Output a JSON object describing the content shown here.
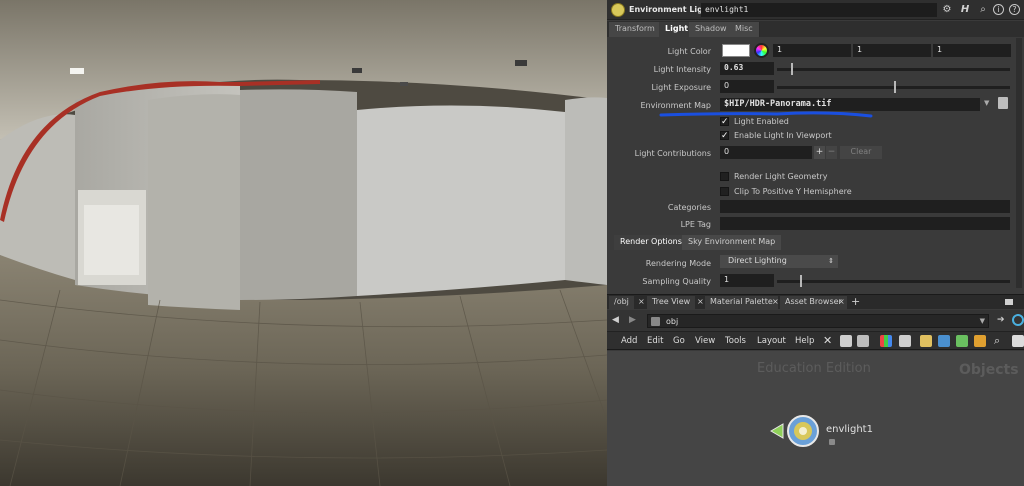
{
  "parameter_editor": {
    "node_type": "Environment Light",
    "node_name": "envlight1",
    "tabs": [
      "Transform",
      "Light",
      "Shadow",
      "Misc"
    ],
    "active_tab": "Light",
    "light_color": {
      "label": "Light Color",
      "values": [
        "1",
        "1",
        "1"
      ],
      "swatch": "#ffffff"
    },
    "light_intensity": {
      "label": "Light Intensity",
      "value": "0.63",
      "slider_fraction": 0.06
    },
    "light_exposure": {
      "label": "Light Exposure",
      "value": "0",
      "slider_fraction": 0.5
    },
    "environment_map": {
      "label": "Environment Map",
      "value": "$HIP/HDR-Panorama.tif"
    },
    "light_enabled": {
      "label": "Light Enabled",
      "checked": true
    },
    "enable_light_in_viewport": {
      "label": "Enable Light In Viewport",
      "checked": true
    },
    "light_contributions": {
      "label": "Light Contributions",
      "value": "0",
      "plus": "+",
      "minus": "−",
      "clear": "Clear"
    },
    "render_light_geometry": {
      "label": "Render Light Geometry",
      "checked": false
    },
    "clip_positive_y": {
      "label": "Clip To Positive Y Hemisphere",
      "checked": false
    },
    "categories": {
      "label": "Categories",
      "value": ""
    },
    "lpe_tag": {
      "label": "LPE Tag",
      "value": ""
    },
    "subtabs": [
      "Render Options",
      "Sky Environment Map"
    ],
    "rendering_mode": {
      "label": "Rendering Mode",
      "value": "Direct Lighting"
    },
    "sampling_quality": {
      "label": "Sampling Quality",
      "value": "1",
      "slider_fraction": 0.1
    }
  },
  "network_pane": {
    "tabs": [
      "/obj",
      "Tree View",
      "Material Palette",
      "Asset Browser"
    ],
    "add_tab": "+",
    "path": "obj",
    "menu": [
      "Add",
      "Edit",
      "Go",
      "View",
      "Tools",
      "Layout",
      "Help"
    ],
    "watermark": "Education Edition",
    "context_label": "Objects",
    "node_label": "envlight1"
  },
  "icons": {
    "gear": "gear-icon",
    "houdini": "houdini-logo-icon",
    "search": "search-icon",
    "info": "info-icon",
    "help": "help-icon"
  },
  "colors": {
    "annotation_underline": "#1a4fe0",
    "node_color": "#d8c85a",
    "node_bulb": "#6aa0d8"
  }
}
